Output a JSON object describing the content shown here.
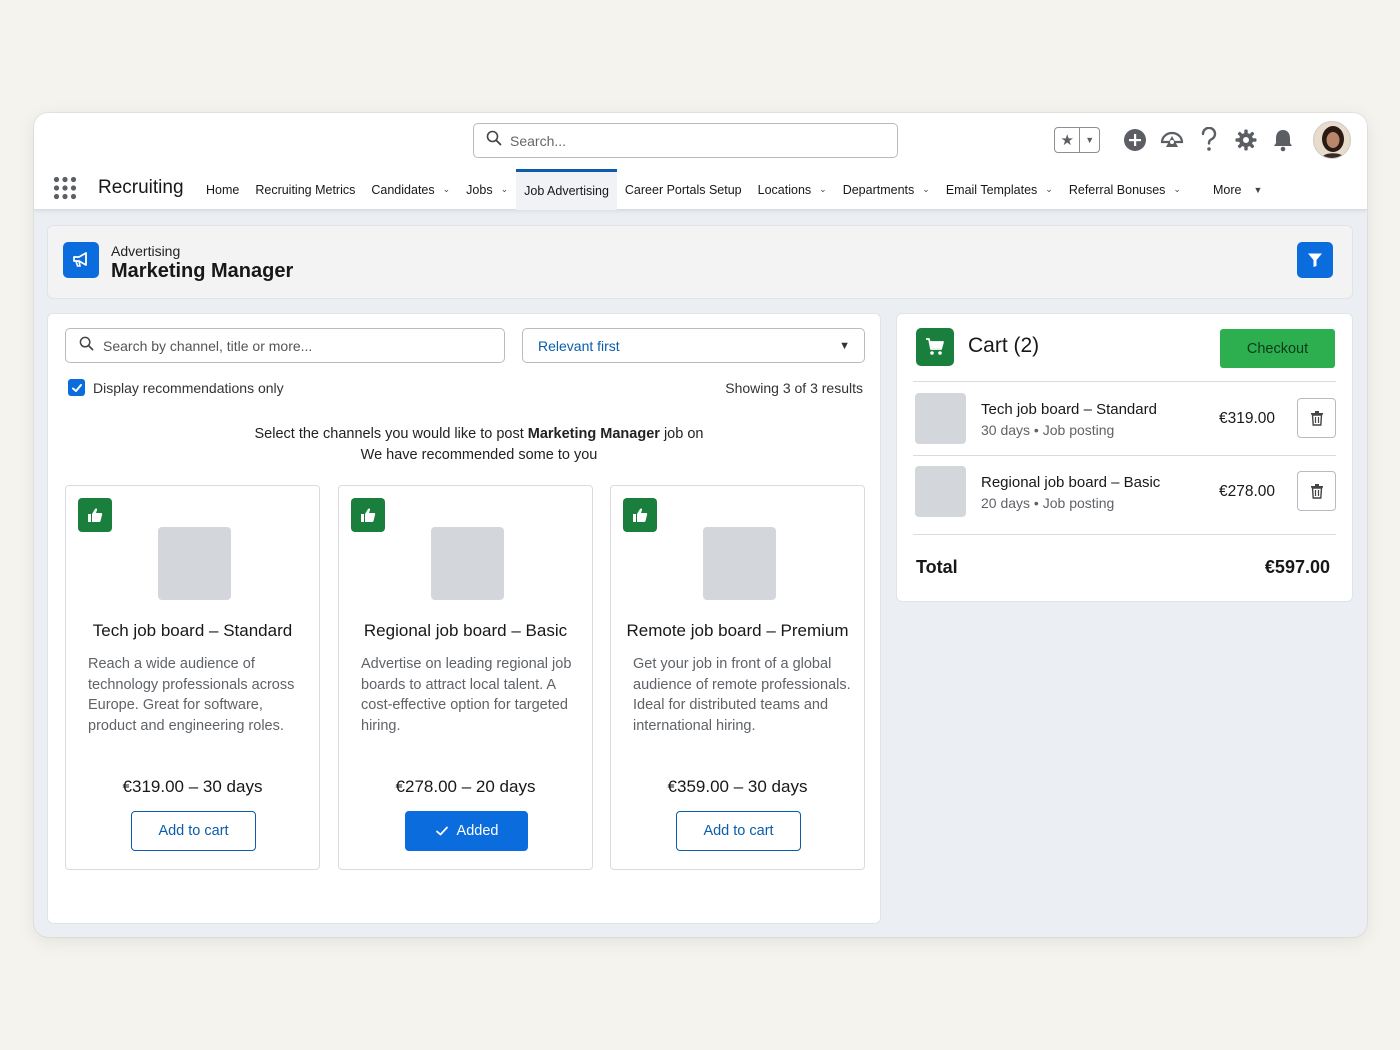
{
  "global_search": {
    "placeholder": "Search..."
  },
  "app": {
    "name": "Recruiting"
  },
  "nav": {
    "tabs": [
      {
        "label": "Home",
        "has_menu": false,
        "active": false
      },
      {
        "label": "Recruiting Metrics",
        "has_menu": false,
        "active": false
      },
      {
        "label": "Candidates",
        "has_menu": true,
        "active": false
      },
      {
        "label": "Jobs",
        "has_menu": true,
        "active": false
      },
      {
        "label": "Job Advertising",
        "has_menu": false,
        "active": true
      },
      {
        "label": "Career Portals Setup",
        "has_menu": false,
        "active": false
      },
      {
        "label": "Locations",
        "has_menu": true,
        "active": false
      },
      {
        "label": "Departments",
        "has_menu": true,
        "active": false
      },
      {
        "label": "Email Templates",
        "has_menu": true,
        "active": false
      },
      {
        "label": "Referral Bonuses",
        "has_menu": true,
        "active": false
      },
      {
        "label": "More",
        "has_menu": true,
        "active": false
      }
    ]
  },
  "header": {
    "object_label": "Advertising",
    "title": "Marketing Manager"
  },
  "filters": {
    "search_placeholder": "Search by channel, title or more...",
    "sort_value": "Relevant first",
    "recommendations_label": "Display recommendations only",
    "recommendations_checked": true,
    "results_text": "Showing 3 of 3 results"
  },
  "intro": {
    "line1_prefix": "Select the channels you would like to post ",
    "line1_job": "Marketing Manager",
    "line1_suffix": " job on",
    "line2": "We have recommended some to you"
  },
  "channels": [
    {
      "title": "Tech job board – Standard",
      "description": "Reach a wide audience of technology professionals across Europe. Great for software, product and engineering roles.",
      "price": "€319.00 – 30 days",
      "button": "Add to cart",
      "added": false
    },
    {
      "title": "Regional job board – Basic",
      "description": "Advertise on leading regional job boards to attract local talent. A cost-effective option for targeted hiring.",
      "price": "€278.00 – 20 days",
      "button": "Added",
      "added": true
    },
    {
      "title": "Remote job board – Premium",
      "description": "Get your job in front of a global audience of remote professionals. Ideal for distributed teams and international hiring.",
      "price": "€359.00 – 30 days",
      "button": "Add to cart",
      "added": false
    }
  ],
  "cart": {
    "title": "Cart (2)",
    "checkout_label": "Checkout",
    "items": [
      {
        "name": "Tech job board – Standard",
        "duration": "30 days",
        "type": "Job posting",
        "price": "€319.00"
      },
      {
        "name": "Regional job board – Basic",
        "duration": "20 days",
        "type": "Job posting",
        "price": "€278.00"
      }
    ],
    "total_label": "Total",
    "total_value": "€597.00"
  },
  "colors": {
    "brand_blue": "#0b6cde",
    "accent_green": "#1a7f3c",
    "checkout_green": "#2eaf4f"
  },
  "icons": [
    "search-icon",
    "star-icon",
    "add-icon",
    "trailhead-icon",
    "help-icon",
    "gear-icon",
    "bell-icon",
    "app-launcher-icon",
    "megaphone-icon",
    "filter-icon",
    "thumbs-up-icon",
    "cart-icon",
    "trash-icon",
    "check-icon"
  ]
}
